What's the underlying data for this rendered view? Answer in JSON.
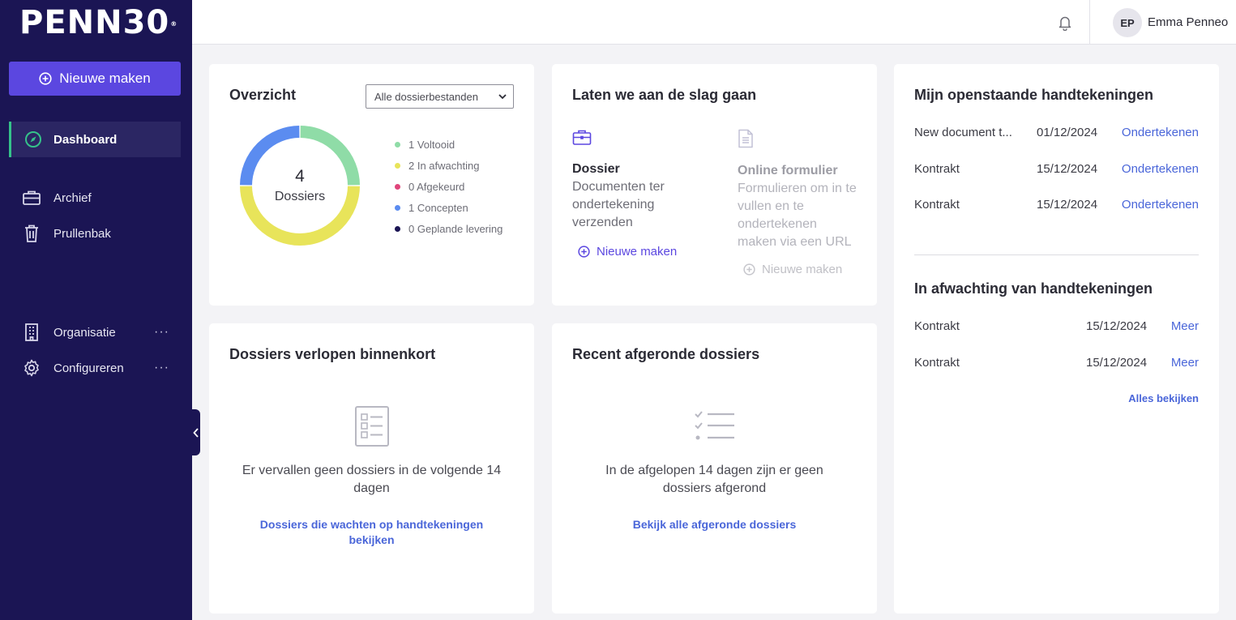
{
  "sidebar": {
    "logo": "PENN30",
    "logo_mark": "®",
    "new_button": "Nieuwe maken",
    "items": [
      {
        "label": "Dashboard"
      },
      {
        "label": "Archief"
      },
      {
        "label": "Prullenbak"
      },
      {
        "label": "Organisatie",
        "more": "···"
      },
      {
        "label": "Configureren",
        "more": "···"
      }
    ]
  },
  "header": {
    "avatar_initials": "EP",
    "user_name": "Emma Penneo"
  },
  "overview": {
    "title": "Overzicht",
    "filter_value": "Alle dossierbestanden",
    "total": "4",
    "total_label": "Dossiers",
    "legend": [
      {
        "label": "1 Voltooid",
        "value": 1,
        "color": "#8fdca7"
      },
      {
        "label": "2 In afwachting",
        "value": 2,
        "color": "#e8e45a"
      },
      {
        "label": "0 Afgekeurd",
        "value": 0,
        "color": "#e0457b"
      },
      {
        "label": "1 Concepten",
        "value": 1,
        "color": "#5b8cf0"
      },
      {
        "label": "0 Geplande levering",
        "value": 0,
        "color": "#1b1554"
      }
    ]
  },
  "getting_started": {
    "title": "Laten we aan de slag gaan",
    "dossier": {
      "title": "Dossier",
      "description": "Documenten ter ondertekening verzenden",
      "link": "Nieuwe maken"
    },
    "form": {
      "title": "Online formulier",
      "description": "Formulieren om in te vullen en te ondertekenen maken via een URL",
      "link": "Nieuwe maken"
    }
  },
  "my_signatures": {
    "title": "Mijn openstaande handtekeningen",
    "rows": [
      {
        "name": "New document t...",
        "date": "01/12/2024",
        "action": "Ondertekenen"
      },
      {
        "name": "Kontrakt",
        "date": "15/12/2024",
        "action": "Ondertekenen"
      },
      {
        "name": "Kontrakt",
        "date": "15/12/2024",
        "action": "Ondertekenen"
      }
    ],
    "awaiting_title": "In afwachting van handtekeningen",
    "awaiting_rows": [
      {
        "name": "Kontrakt",
        "date": "15/12/2024",
        "action": "Meer"
      },
      {
        "name": "Kontrakt",
        "date": "15/12/2024",
        "action": "Meer"
      }
    ],
    "see_all": "Alles bekijken"
  },
  "expiring": {
    "title": "Dossiers verlopen binnenkort",
    "empty_text": "Er vervallen geen dossiers in de volgende 14 dagen",
    "link": "Dossiers die wachten op handtekeningen bekijken"
  },
  "recent": {
    "title": "Recent afgeronde dossiers",
    "empty_text": "In de afgelopen 14 dagen zijn er geen dossiers afgerond",
    "link": "Bekijk alle afgeronde dossiers"
  }
}
